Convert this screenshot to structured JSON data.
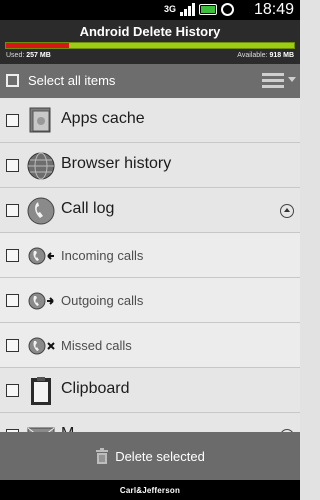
{
  "status_bar": {
    "network": "3G",
    "time": "18:49",
    "icons": [
      "signal-icon",
      "battery-icon",
      "alarm-icon"
    ]
  },
  "header": {
    "title": "Android Delete History",
    "used_label": "Used:",
    "used_value": "257 MB",
    "available_label": "Available:",
    "available_value": "918 MB",
    "storage_used_fraction": 0.219
  },
  "select_all": {
    "label": "Select all items"
  },
  "items": [
    {
      "label": "Apps cache",
      "icon": "apps-cache-icon"
    },
    {
      "label": "Browser history",
      "icon": "globe-icon"
    },
    {
      "label": "Call log",
      "icon": "phone-icon",
      "expanded": true
    },
    {
      "label": "Incoming calls",
      "icon": "incoming-call-icon"
    },
    {
      "label": "Outgoing calls",
      "icon": "outgoing-call-icon"
    },
    {
      "label": "Missed calls",
      "icon": "missed-call-icon"
    },
    {
      "label": "Clipboard",
      "icon": "clipboard-icon"
    },
    {
      "label": "M",
      "icon": "mail-icon"
    }
  ],
  "footer": {
    "delete_label": "Delete selected"
  },
  "brand": "Carl&Jefferson",
  "colors": {
    "used": "#d81818",
    "available": "#9ccc14",
    "header_bg": "#2b2b2b",
    "footer_bg": "#6b6b6b"
  }
}
